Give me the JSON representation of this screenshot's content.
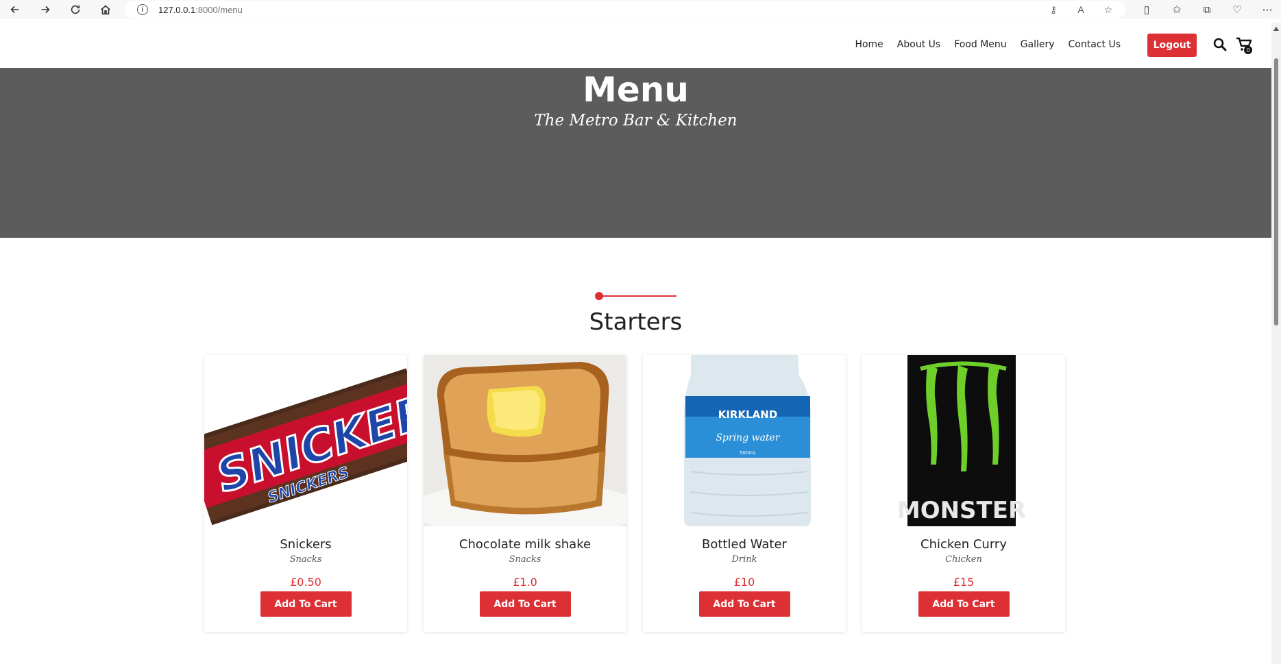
{
  "browser": {
    "url_host": "127.0.0.1",
    "url_rest": ":8000/menu"
  },
  "nav": {
    "items": [
      "Home",
      "About Us",
      "Food Menu",
      "Gallery",
      "Contact Us"
    ],
    "logout_label": "Logout",
    "cart_count": "0"
  },
  "hero": {
    "title": "Menu",
    "subtitle": "The Metro Bar & Kitchen"
  },
  "section": {
    "title": "Starters"
  },
  "products": [
    {
      "name": "Snickers",
      "category": "Snacks",
      "price": "£0.50",
      "button": "Add To Cart",
      "image": "snickers-bar"
    },
    {
      "name": "Chocolate milk shake",
      "category": "Snacks",
      "price": "£1.0",
      "button": "Add To Cart",
      "image": "buttered-toast"
    },
    {
      "name": "Bottled Water",
      "category": "Drink",
      "price": "£10",
      "button": "Add To Cart",
      "image": "water-bottle"
    },
    {
      "name": "Chicken Curry",
      "category": "Chicken",
      "price": "£15",
      "button": "Add To Cart",
      "image": "monster-can"
    }
  ],
  "colors": {
    "accent": "#dc3035",
    "hero_bg": "#5c5c5c"
  }
}
